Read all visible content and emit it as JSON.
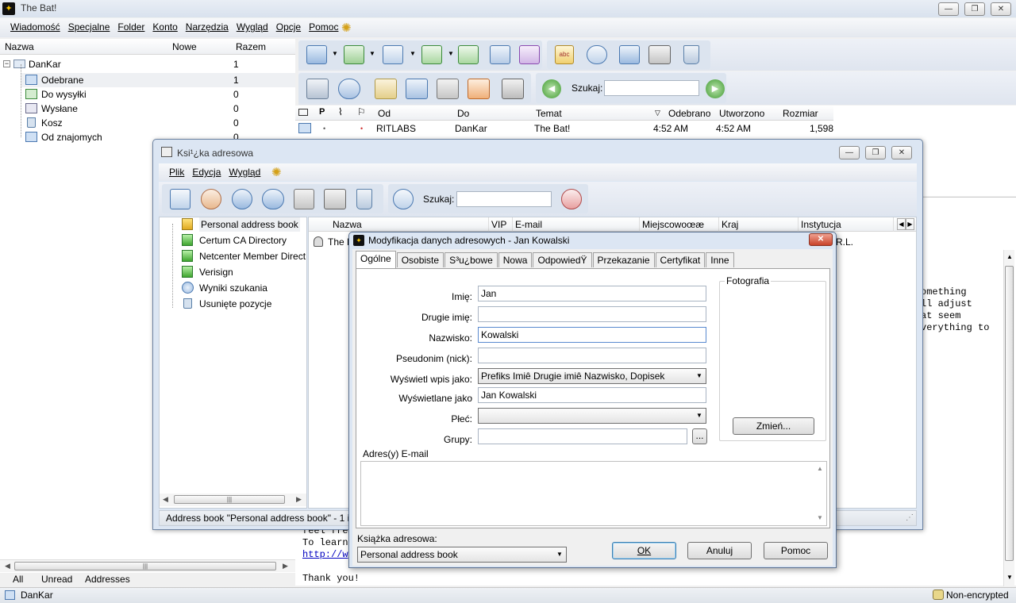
{
  "app": {
    "title": "The Bat!",
    "menu": [
      "Wiadomość",
      "Specjalne",
      "Folder",
      "Konto",
      "Narzędzia",
      "Wygląd",
      "Opcje",
      "Pomoc"
    ]
  },
  "folders": {
    "headers": {
      "name": "Nazwa",
      "new": "Nowe",
      "total": "Razem"
    },
    "account": {
      "name": "DanKar",
      "total": "1"
    },
    "items": [
      {
        "name": "Odebrane",
        "total": "1"
      },
      {
        "name": "Do wysyłki",
        "total": "0"
      },
      {
        "name": "Wysłane",
        "total": "0"
      },
      {
        "name": "Kosz",
        "total": "0"
      },
      {
        "name": "Od znajomych",
        "total": "0"
      }
    ],
    "bottom_tabs": [
      "All",
      "Unread",
      "Addresses"
    ]
  },
  "search": {
    "label": "Szukaj:"
  },
  "message_list": {
    "headers": {
      "from": "Od",
      "to": "Do",
      "subject": "Temat",
      "received": "Odebrano",
      "created": "Utworzono",
      "size": "Rozmiar"
    },
    "rows": [
      {
        "from": "RITLABS",
        "to": "DanKar",
        "subject": "The Bat!",
        "received": "4:52 AM",
        "created": "4:52 AM",
        "size": "1,598"
      }
    ]
  },
  "preview": {
    "right_lines": [
      "omething",
      "ll adjust",
      "at seem",
      "verything to"
    ],
    "bottom_lines": [
      "feel fre",
      "To learn",
      "http://w",
      "",
      "Thank you!"
    ]
  },
  "status": {
    "account": "DanKar",
    "encryption": "Non-encrypted"
  },
  "address_book": {
    "title": "Ksi¹¿ka adresowa",
    "menu": [
      "Plik",
      "Edycja",
      "Wygląd"
    ],
    "search_label": "Szukaj:",
    "tree": [
      "Personal address book",
      "Certum CA Directory",
      "Netcenter Member Directory",
      "Verisign",
      "Wyniki szukania",
      "Usunięte pozycje"
    ],
    "list_headers": {
      "name": "Nazwa",
      "vip": "VIP",
      "email": "E-mail",
      "city": "Miejscowoœæ",
      "country": "Kraj",
      "org": "Instytucja"
    },
    "list_rows": [
      {
        "name": "The B",
        "org_tail": "R.L."
      }
    ],
    "status": "Address book \"Personal address book\" - 1 ite"
  },
  "dialog": {
    "title": "Modyfikacja danych adresowych - Jan Kowalski",
    "tabs": [
      "Ogólne",
      "Osobiste",
      "S³u¿bowe",
      "Nowa",
      "OdpowiedŸ",
      "Przekazanie",
      "Certyfikat",
      "Inne"
    ],
    "labels": {
      "first": "Imię:",
      "middle": "Drugie imię:",
      "last": "Nazwisko:",
      "nick": "Pseudonim (nick):",
      "display_as": "Wyświetl wpis jako:",
      "displayed": "Wyświetlane jako",
      "gender": "Płeć:",
      "groups": "Grupy:",
      "photo": "Fotografia",
      "emails": "Adres(y) E-mail",
      "book": "Książka adresowa:"
    },
    "values": {
      "first": "Jan",
      "middle": "",
      "last": "Kowalski",
      "nick": "",
      "display_as": "Prefiks Imiê Drugie imiê Nazwisko, Dopisek",
      "displayed": "Jan Kowalski",
      "gender": "",
      "groups": "",
      "book": "Personal address book"
    },
    "buttons": {
      "change": "Zmień...",
      "ok": "OK",
      "cancel": "Anuluj",
      "help": "Pomoc",
      "groups_more": "..."
    }
  }
}
